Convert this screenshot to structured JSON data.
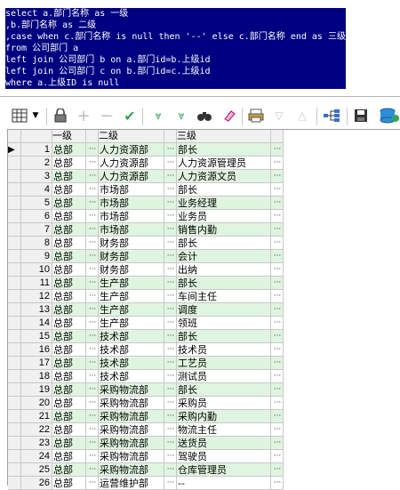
{
  "sql": {
    "lines": [
      "select a.部门名称 as 一级",
      ",b.部门名称 as 二级",
      ",case when c.部门名称 is null then '--' else c.部门名称 end as 三级",
      "from 公司部门 a",
      "left join 公司部门 b on a.部门id=b.上级id",
      "left join 公司部门 c on b.部门id=c.上级id",
      "where a.上级ID is null"
    ]
  },
  "toolbar": {
    "icons": [
      "grid-view-icon",
      "dropdown-arrow-icon",
      "lock-icon",
      "add-icon",
      "remove-icon",
      "check-icon",
      "filter-down-icon",
      "filter-clear-icon",
      "binoculars-icon",
      "eraser-icon",
      "print-icon",
      "sort-asc-icon",
      "sort-desc-icon",
      "tree-icon",
      "save-icon",
      "database-icon"
    ]
  },
  "grid": {
    "columns": [
      "一级",
      "二级",
      "三级"
    ],
    "ellipsis": "···",
    "rows": [
      {
        "n": "1",
        "a": "总部",
        "b": "人力资源部",
        "c": "部长"
      },
      {
        "n": "2",
        "a": "总部",
        "b": "人力资源部",
        "c": "人力资源管理员"
      },
      {
        "n": "3",
        "a": "总部",
        "b": "人力资源部",
        "c": "人力资源文员"
      },
      {
        "n": "4",
        "a": "总部",
        "b": "市场部",
        "c": "部长"
      },
      {
        "n": "5",
        "a": "总部",
        "b": "市场部",
        "c": "业务经理"
      },
      {
        "n": "6",
        "a": "总部",
        "b": "市场部",
        "c": "业务员"
      },
      {
        "n": "7",
        "a": "总部",
        "b": "市场部",
        "c": "销售内勤"
      },
      {
        "n": "8",
        "a": "总部",
        "b": "财务部",
        "c": "部长"
      },
      {
        "n": "9",
        "a": "总部",
        "b": "财务部",
        "c": "会计"
      },
      {
        "n": "10",
        "a": "总部",
        "b": "财务部",
        "c": "出纳"
      },
      {
        "n": "11",
        "a": "总部",
        "b": "生产部",
        "c": "部长"
      },
      {
        "n": "12",
        "a": "总部",
        "b": "生产部",
        "c": "车间主任"
      },
      {
        "n": "13",
        "a": "总部",
        "b": "生产部",
        "c": "调度"
      },
      {
        "n": "14",
        "a": "总部",
        "b": "生产部",
        "c": "领班"
      },
      {
        "n": "15",
        "a": "总部",
        "b": "技术部",
        "c": "部长"
      },
      {
        "n": "16",
        "a": "总部",
        "b": "技术部",
        "c": "技术员"
      },
      {
        "n": "17",
        "a": "总部",
        "b": "技术部",
        "c": "工艺员"
      },
      {
        "n": "18",
        "a": "总部",
        "b": "技术部",
        "c": "测试员"
      },
      {
        "n": "19",
        "a": "总部",
        "b": "采购物流部",
        "c": "部长"
      },
      {
        "n": "20",
        "a": "总部",
        "b": "采购物流部",
        "c": "采购员"
      },
      {
        "n": "21",
        "a": "总部",
        "b": "采购物流部",
        "c": "采购内勤"
      },
      {
        "n": "22",
        "a": "总部",
        "b": "采购物流部",
        "c": "物流主任"
      },
      {
        "n": "23",
        "a": "总部",
        "b": "采购物流部",
        "c": "送货员"
      },
      {
        "n": "24",
        "a": "总部",
        "b": "采购物流部",
        "c": "驾驶员"
      },
      {
        "n": "25",
        "a": "总部",
        "b": "采购物流部",
        "c": "仓库管理员"
      },
      {
        "n": "26",
        "a": "总部",
        "b": "运营维护部",
        "c": "--"
      }
    ]
  },
  "colors": {
    "selection": "#000080",
    "row_green": "#dff5df",
    "toolbar_green": "#3aa35b"
  }
}
